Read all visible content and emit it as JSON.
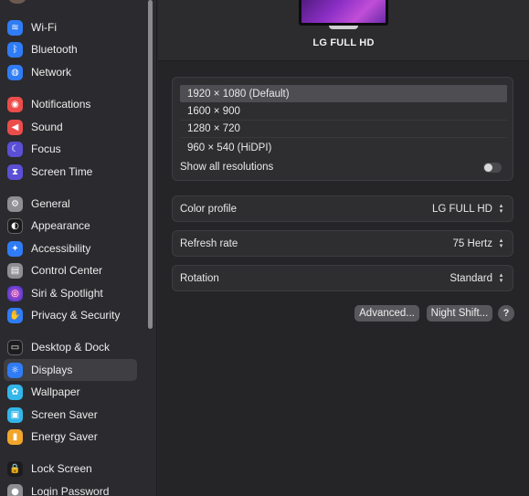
{
  "sidebar": {
    "items": [
      {
        "label": "Wi-Fi",
        "icon": "wifi-icon",
        "color": "#2f7cf6",
        "glyph": "≋"
      },
      {
        "label": "Bluetooth",
        "icon": "bluetooth-icon",
        "color": "#2f7cf6",
        "glyph": "ᛒ"
      },
      {
        "label": "Network",
        "icon": "globe-icon",
        "color": "#2f7cf6",
        "glyph": "◍"
      },
      {
        "label": "Notifications",
        "icon": "bell-icon",
        "color": "#eb4d4b",
        "glyph": "◉"
      },
      {
        "label": "Sound",
        "icon": "speaker-icon",
        "color": "#eb4d4b",
        "glyph": "◀"
      },
      {
        "label": "Focus",
        "icon": "moon-icon",
        "color": "#5b4fd6",
        "glyph": "☾"
      },
      {
        "label": "Screen Time",
        "icon": "hourglass-icon",
        "color": "#5b4fd6",
        "glyph": "⧗"
      },
      {
        "label": "General",
        "icon": "gear-icon",
        "color": "#8e8e93",
        "glyph": "⚙"
      },
      {
        "label": "Appearance",
        "icon": "appearance-icon",
        "color": "#1c1c1e",
        "glyph": "◐"
      },
      {
        "label": "Accessibility",
        "icon": "accessibility-icon",
        "color": "#2f7cf6",
        "glyph": "✦"
      },
      {
        "label": "Control Center",
        "icon": "control-center-icon",
        "color": "#8e8e93",
        "glyph": "▤"
      },
      {
        "label": "Siri & Spotlight",
        "icon": "siri-icon",
        "color": "#9b3fd6",
        "glyph": "◎"
      },
      {
        "label": "Privacy & Security",
        "icon": "hand-icon",
        "color": "#2f7cf6",
        "glyph": "✋"
      },
      {
        "label": "Desktop & Dock",
        "icon": "dock-icon",
        "color": "#1c1c1e",
        "glyph": "▭"
      },
      {
        "label": "Displays",
        "icon": "sun-icon",
        "color": "#2f7cf6",
        "glyph": "☼"
      },
      {
        "label": "Wallpaper",
        "icon": "wallpaper-icon",
        "color": "#33b6e8",
        "glyph": "✿"
      },
      {
        "label": "Screen Saver",
        "icon": "screen-saver-icon",
        "color": "#33b6e8",
        "glyph": "▣"
      },
      {
        "label": "Energy Saver",
        "icon": "battery-icon",
        "color": "#f2a52b",
        "glyph": "▮"
      },
      {
        "label": "Lock Screen",
        "icon": "lock-icon",
        "color": "#1c1c1e",
        "glyph": "🔒"
      },
      {
        "label": "Login Password",
        "icon": "password-icon",
        "color": "#8e8e93",
        "glyph": "●"
      }
    ],
    "selected": "Displays"
  },
  "display": {
    "name": "LG FULL HD"
  },
  "resolutions": {
    "options": [
      "1920 × 1080 (Default)",
      "1600 × 900",
      "1280 × 720",
      "960 × 540 (HiDPI)"
    ],
    "selected_index": 0,
    "show_all_label": "Show all resolutions",
    "show_all_enabled": false
  },
  "settings": {
    "color_profile": {
      "label": "Color profile",
      "value": "LG FULL HD"
    },
    "refresh_rate": {
      "label": "Refresh rate",
      "value": "75 Hertz"
    },
    "rotation": {
      "label": "Rotation",
      "value": "Standard"
    }
  },
  "buttons": {
    "advanced": "Advanced...",
    "night_shift": "Night Shift...",
    "help": "?"
  },
  "glyphs": {
    "stepper": "▴▾"
  }
}
